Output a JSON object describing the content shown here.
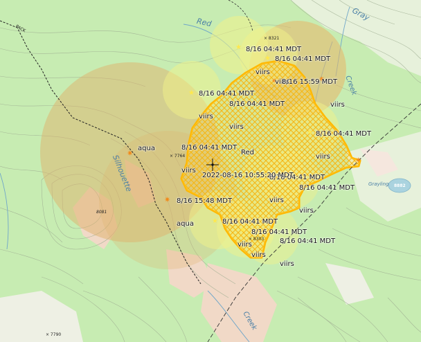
{
  "map": {
    "colors": {
      "forest": "#c7ecb2",
      "meadow": "#e9f1dc",
      "rock": "#f1d8c6",
      "contour": "#9aa88e",
      "water": "#aad3df",
      "perimeter": "#ffb800",
      "perimeter_fill": "#ffd84a",
      "detection_orange": "#f0a94a",
      "detection_yellow": "#f1f28a",
      "trail": "#222222"
    },
    "terrain_labels": {
      "creek_red": "Red",
      "creek_gray": "Gray",
      "creek_right": "Creek",
      "silhouette": "Silhouette",
      "lake": "Grayling",
      "bottom_creek": "Creek"
    },
    "trail_label": "PACK",
    "elevations": {
      "peak_8081": "8081",
      "lake_elev": "8882",
      "spot_7790": "× 7790",
      "spot_7764": "× 7764",
      "spot_8303": "× 8303",
      "spot_8321": "× 8321"
    },
    "detections": [
      {
        "id": "d1",
        "time": "8/16 04:41 MDT",
        "sensor": "viirs"
      },
      {
        "id": "d2",
        "time": "8/16 04:41 MDT",
        "sensor": "viirs"
      },
      {
        "id": "d3",
        "time": "8/16 15:59 MDT",
        "sensor": "viirs"
      },
      {
        "id": "d4",
        "time": "8/16 04:41 MDT",
        "sensor": "viirs"
      },
      {
        "id": "d5",
        "time": "8/16 04:41 MDT",
        "sensor": "viirs"
      },
      {
        "id": "d6",
        "time": "8/16 04:41 MDT",
        "sensor": "viirs"
      },
      {
        "id": "d7",
        "time": "8/16 04:41 MDT",
        "sensor": "viirs"
      },
      {
        "id": "d8",
        "time": "8/16 04:41 MDT",
        "sensor": "viirs"
      },
      {
        "id": "d9",
        "time": "8/16 04:41 MDT",
        "sensor": "viirs"
      },
      {
        "id": "d10",
        "time": "8/16 15:48 MDT",
        "sensor": "aqua"
      },
      {
        "id": "d11",
        "time": "8/16 04:41 MDT",
        "sensor": "viirs"
      },
      {
        "id": "d12",
        "time": "8/16 04:41 MDT",
        "sensor": "viirs"
      },
      {
        "id": "d13",
        "time": "8/16 04:41 MDT",
        "sensor": "viirs"
      }
    ],
    "aqua_label": "aqua",
    "fire": {
      "name": "Red",
      "timestamp": "2022-08-16 10:55:20 MDT"
    }
  }
}
